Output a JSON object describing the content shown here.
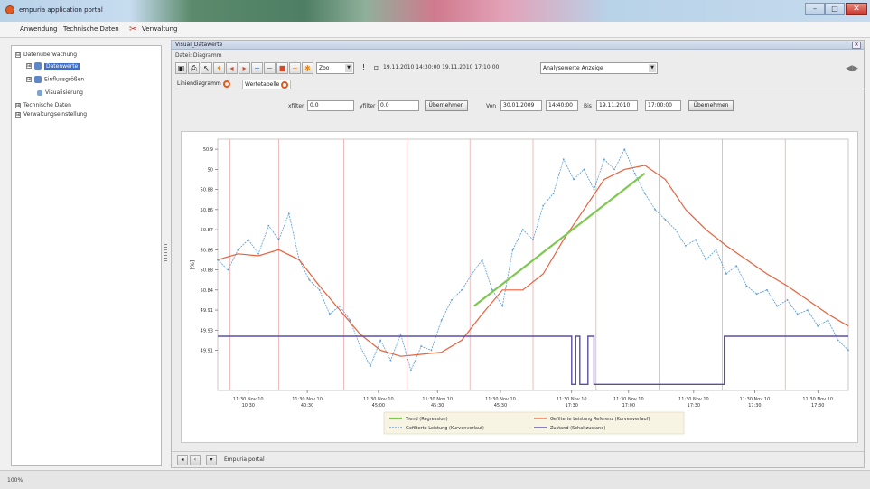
{
  "window": {
    "title": "empuria application portal",
    "min_label": "–",
    "max_label": "□",
    "close_label": "✕"
  },
  "menu": {
    "items": [
      "Anwendung",
      "Technische Daten",
      "Verwaltung"
    ]
  },
  "tree": {
    "items": [
      {
        "label": "Datenüberwachung",
        "level": 0,
        "expander": "⊟",
        "selected": false
      },
      {
        "label": "Datenwerte",
        "level": 1,
        "expander": "⊞",
        "selected": true
      },
      {
        "label": "Einflussgrößen",
        "level": 1,
        "expander": "⊞",
        "selected": false
      },
      {
        "label": "Visualisierung",
        "level": 2,
        "expander": "",
        "selected": false
      },
      {
        "label": "Technische Daten",
        "level": 0,
        "expander": "⊞",
        "selected": false
      },
      {
        "label": "Verwaltungseinstellung",
        "level": 0,
        "expander": "⊞",
        "selected": false
      }
    ]
  },
  "panel": {
    "tab_title": "Visual_Datawerte",
    "tab_close": "✕",
    "datei_label": "Datei: Diagramm"
  },
  "toolbar": {
    "zoom_select": "Zoo",
    "date_range": "19.11.2010 14:30:00 19.11.2010 17:10:00",
    "mode_select": "Analysewerte Anzeige"
  },
  "subtabs": [
    {
      "label": "Liniendiagramm",
      "active": false
    },
    {
      "label": "Wertetabelle",
      "active": true
    }
  ],
  "filters": {
    "xfilter_label": "xfilter",
    "xfilter_value": "0.0",
    "yfilter_label": "yfilter",
    "yfilter_value": "0.0",
    "apply1_label": "Übernehmen",
    "von_label": "Von",
    "von_date": "30.01.2009",
    "von_time": "14:40:00",
    "bis_label": "Bis",
    "bis_date": "19.11.2010",
    "bis_time": "17:00:00",
    "apply2_label": "Übernehmen"
  },
  "bottombar": {
    "status_text": "Empuria portal"
  },
  "statusbar": {
    "text": "100%"
  },
  "colors": {
    "series_raw": "#5b9bd5",
    "series_smooth": "#e8603c",
    "trend": "#7ec850",
    "state": "#5b4ea8",
    "gridline_vertical": "#e6a1a1"
  },
  "chart_data": {
    "type": "line",
    "ylabel": "[%]",
    "ylim": [
      49.8,
      51.05
    ],
    "yticks": [
      {
        "v": 51.0,
        "label": "50.9"
      },
      {
        "v": 50.9,
        "label": "50"
      },
      {
        "v": 50.8,
        "label": "50.88"
      },
      {
        "v": 50.7,
        "label": "50.86"
      },
      {
        "v": 50.6,
        "label": "50.87"
      },
      {
        "v": 50.5,
        "label": "50.86"
      },
      {
        "v": 50.4,
        "label": "50.88"
      },
      {
        "v": 50.3,
        "label": "50.84"
      },
      {
        "v": 50.2,
        "label": "49.91"
      },
      {
        "v": 50.1,
        "label": "49.93"
      },
      {
        "v": 50.0,
        "label": "49.91"
      }
    ],
    "xticks": [
      {
        "x": 1.5,
        "line1": "11:30 Nov 10",
        "line2": "10:30"
      },
      {
        "x": 4.4,
        "line1": "11:30 Nov 10",
        "line2": "40:30"
      },
      {
        "x": 7.9,
        "line1": "11:30 Nov 10",
        "line2": "45:00"
      },
      {
        "x": 10.8,
        "line1": "11:30 Nov 10",
        "line2": "45:30"
      },
      {
        "x": 13.9,
        "line1": "11:30 Nov 10",
        "line2": "45:30"
      },
      {
        "x": 17.4,
        "line1": "11:30 Nov 10",
        "line2": "17:30"
      },
      {
        "x": 20.2,
        "line1": "11:30 Nov 10",
        "line2": "17:00"
      },
      {
        "x": 23.4,
        "line1": "11:30 Nov 10",
        "line2": "17:30"
      },
      {
        "x": 26.4,
        "line1": "11:30 Nov 10",
        "line2": "17:30"
      },
      {
        "x": 29.5,
        "line1": "11:30 Nov 10",
        "line2": "17:30"
      }
    ],
    "xlim": [
      0,
      31
    ],
    "vertical_gridlines": [
      0.6,
      3.0,
      6.2,
      9.3,
      12.4,
      15.5,
      18.6,
      21.7,
      24.8,
      27.9
    ],
    "series": [
      {
        "name": "Gefilterte Leistung (Kurvenverlauf)",
        "style": "raw",
        "x": [
          0,
          0.5,
          1,
          1.5,
          2,
          2.5,
          3,
          3.5,
          4,
          4.5,
          5,
          5.5,
          6,
          6.5,
          7,
          7.5,
          8,
          8.5,
          9,
          9.5,
          10,
          10.5,
          11,
          11.5,
          12,
          12.5,
          13,
          13.5,
          14,
          14.5,
          15,
          15.5,
          16,
          16.5,
          17,
          17.5,
          18,
          18.5,
          19,
          19.5,
          20,
          20.5,
          21,
          21.5,
          22,
          22.5,
          23,
          23.5,
          24,
          24.5,
          25,
          25.5,
          26,
          26.5,
          27,
          27.5,
          28,
          28.5,
          29,
          29.5,
          30,
          30.5,
          31
        ],
        "y": [
          50.45,
          50.4,
          50.5,
          50.55,
          50.48,
          50.62,
          50.55,
          50.68,
          50.45,
          50.35,
          50.3,
          50.18,
          50.22,
          50.15,
          50.02,
          49.92,
          50.05,
          49.95,
          50.08,
          49.9,
          50.02,
          50.0,
          50.15,
          50.25,
          50.3,
          50.38,
          50.45,
          50.3,
          50.22,
          50.5,
          50.6,
          50.55,
          50.72,
          50.78,
          50.95,
          50.85,
          50.9,
          50.8,
          50.95,
          50.9,
          51.0,
          50.88,
          50.78,
          50.7,
          50.65,
          50.6,
          50.52,
          50.55,
          50.45,
          50.5,
          50.38,
          50.42,
          50.32,
          50.28,
          50.3,
          50.22,
          50.25,
          50.18,
          50.2,
          50.12,
          50.15,
          50.05,
          50.0
        ]
      },
      {
        "name": "Gefilterte Leistung Referenz (Kurvenverlauf)",
        "style": "smooth",
        "x": [
          0,
          1,
          2,
          3,
          4,
          5,
          6,
          7,
          8,
          9,
          10,
          11,
          12,
          13,
          14,
          15,
          16,
          17,
          18,
          19,
          20,
          21,
          22,
          23,
          24,
          25,
          26,
          27,
          28,
          29,
          30,
          31
        ],
        "y": [
          50.45,
          50.48,
          50.47,
          50.5,
          50.45,
          50.32,
          50.2,
          50.08,
          50.0,
          49.97,
          49.98,
          49.99,
          50.05,
          50.18,
          50.3,
          50.3,
          50.38,
          50.55,
          50.7,
          50.85,
          50.9,
          50.92,
          50.85,
          50.7,
          50.6,
          50.52,
          50.45,
          50.38,
          50.32,
          50.25,
          50.18,
          50.12
        ]
      },
      {
        "name": "Trend (Regression)",
        "style": "trend",
        "x": [
          12.6,
          21.0
        ],
        "y": [
          50.22,
          50.88
        ]
      },
      {
        "name": "Zustand (Schaltzustand)",
        "style": "state",
        "x": [
          0,
          17.4,
          17.4,
          17.6,
          17.6,
          17.8,
          17.8,
          18.2,
          18.2,
          18.5,
          18.5,
          24.9,
          24.9,
          31
        ],
        "y": [
          50.07,
          50.07,
          49.83,
          49.83,
          50.07,
          50.07,
          49.83,
          49.83,
          50.07,
          50.07,
          49.83,
          49.83,
          50.07,
          50.07
        ]
      }
    ]
  }
}
